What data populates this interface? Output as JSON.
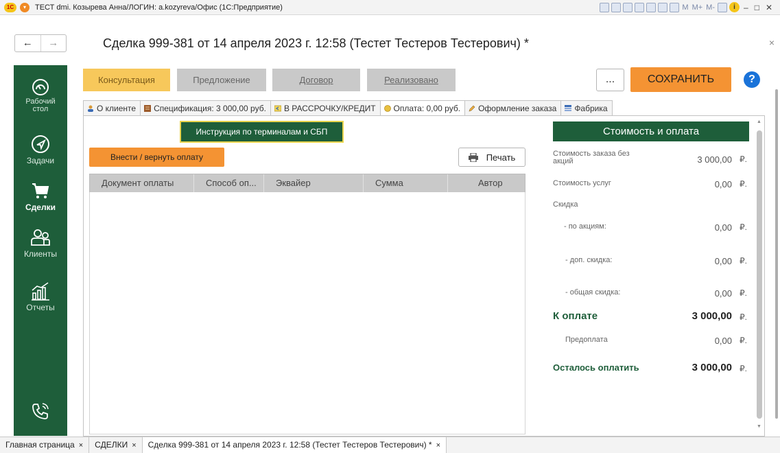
{
  "window": {
    "title": "ТЕСТ dmi. Козырева Анна/ЛОГИН: a.kozyreva/Офис (1С:Предприятие)",
    "logo_text": "1С",
    "toolbar_text": [
      "M",
      "M+",
      "M-"
    ]
  },
  "header": {
    "back": "←",
    "forward": "→",
    "doc_title": "Сделка 999-381 от 14 апреля 2023 г. 12:58 (Тестет Тестеров Тестерович) *",
    "close": "×"
  },
  "sidebar": {
    "items": [
      {
        "label": "Рабочий стол",
        "icon": "speedometer-icon"
      },
      {
        "label": "Задачи",
        "icon": "compass-icon"
      },
      {
        "label": "Сделки",
        "icon": "cart-icon",
        "active": true
      },
      {
        "label": "Клиенты",
        "icon": "users-icon"
      },
      {
        "label": "Отчеты",
        "icon": "reports-icon"
      }
    ],
    "phone_icon": "phone-icon"
  },
  "stages": [
    "Консультация",
    "Предложение",
    "Договор",
    "Реализовано"
  ],
  "actions": {
    "more": "...",
    "save": "СОХРАНИТЬ",
    "help": "?"
  },
  "tabs": [
    {
      "label": "О клиенте",
      "icon": "person-icon"
    },
    {
      "label": "Спецификация: 3 000,00 руб.",
      "icon": "book-icon"
    },
    {
      "label": "В РАССРОЧКУ/КРЕДИТ",
      "icon": "credit-icon"
    },
    {
      "label": "Оплата: 0,00 руб.",
      "icon": "coin-icon",
      "active": true
    },
    {
      "label": "Оформление заказа",
      "icon": "pencil-icon"
    },
    {
      "label": "Фабрика",
      "icon": "list-icon"
    }
  ],
  "payment": {
    "instruction_button": "Инструкция по терминалам и СБП",
    "pay_button": "Внести / вернуть оплату",
    "print_button": "Печать",
    "columns": [
      "Документ оплаты",
      "Способ оп...",
      "Эквайер",
      "Сумма",
      "Автор"
    ]
  },
  "cost": {
    "header": "Стоимость и оплата",
    "currency": "₽.",
    "order_cost_label": "Стоимость заказа без акций",
    "order_cost": "3 000,00",
    "services_label": "Стоимость услуг",
    "services": "0,00",
    "discount_label": "Скидка",
    "promo_label": "- по акциям:",
    "promo": "0,00",
    "extra_label": "- доп. скидка:",
    "extra": "0,00",
    "total_discount_label": "- общая скидка:",
    "total_discount": "0,00",
    "to_pay_label": "К оплате",
    "to_pay": "3 000,00",
    "prepay_label": "Предоплата",
    "prepay": "0,00",
    "remaining_label": "Осталось оплатить",
    "remaining": "3 000,00"
  },
  "bottom_tabs": [
    {
      "label": "Главная страница"
    },
    {
      "label": "СДЕЛКИ"
    },
    {
      "label": "Сделка 999-381 от 14 апреля 2023 г. 12:58 (Тестет Тестеров Тестерович) *",
      "active": true
    }
  ],
  "bottom_close": "×"
}
